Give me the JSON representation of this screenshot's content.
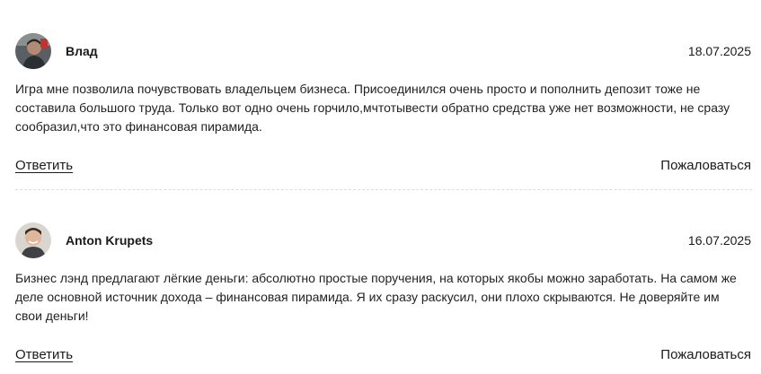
{
  "reviews": [
    {
      "author": "Влад",
      "date": "18.07.2025",
      "avatar_icon": "user-avatar-photo",
      "text": "Игра мне позволила почувствовать владельцем бизнеса. Присоединился очень просто и пополнить депозит тоже не составила большого труда. Только вот одно очень горчило,мчтотывести обратно средства уже нет возможности, не сразу сообразил,что это финансовая пирамида.",
      "reply_label": "Ответить",
      "report_label": "Пожаловаться"
    },
    {
      "author": "Anton Krupets",
      "date": "16.07.2025",
      "avatar_icon": "user-avatar-photo",
      "text": "Бизнес лэнд предлагают лёгкие деньги: абсолютно простые поручения, на которых якобы можно заработать. На самом же деле основной источник дохода – финансовая пирамида. Я их сразу раскусил, они плохо скрываются. Не доверяйте им свои деньги!",
      "reply_label": "Ответить",
      "report_label": "Пожаловаться"
    }
  ]
}
